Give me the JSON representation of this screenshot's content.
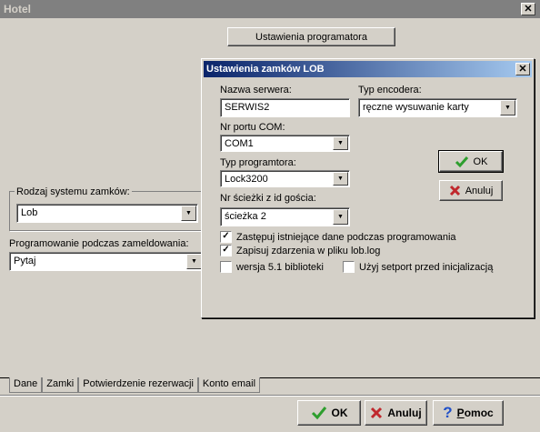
{
  "window": {
    "title": "Hotel",
    "close_glyph": "✕"
  },
  "top_button": {
    "label": "Ustawienia programatora"
  },
  "lock_system": {
    "group_label": "Rodzaj systemu zamków:",
    "value": "Lob"
  },
  "checkin_programming": {
    "label": "Programowanie podczas zameldowania:",
    "value": "Pytaj"
  },
  "tabs": [
    {
      "label": "Dane"
    },
    {
      "label": "Zamki"
    },
    {
      "label": "Potwierdzenie rezerwacji"
    },
    {
      "label": "Konto email"
    }
  ],
  "bottom_buttons": {
    "ok": {
      "label": "OK",
      "icon": "checkmark-icon"
    },
    "cancel": {
      "label": "Anuluj",
      "icon": "x-icon"
    },
    "help": {
      "label": "Pomoc",
      "icon": "question-icon"
    }
  },
  "dialog": {
    "title": "Ustawienia zamków LOB",
    "close_glyph": "✕",
    "server": {
      "label": "Nazwa serwera:",
      "value": "SERWIS2"
    },
    "encoder_type": {
      "label": "Typ encodera:",
      "value": "ręczne wysuwanie karty"
    },
    "com_port": {
      "label": "Nr portu COM:",
      "value": "COM1"
    },
    "programmer_type": {
      "label": "Typ programtora:",
      "value": "Lock3200"
    },
    "track": {
      "label": "Nr ścieżki z id gościa:",
      "value": "ścieżka 2"
    },
    "checkboxes": [
      {
        "label": "Zastępuj istniejące dane podczas programowania",
        "checked": true,
        "mark": "✓"
      },
      {
        "label": "Zapisuj zdarzenia w pliku lob.log",
        "checked": true,
        "mark": "✓"
      },
      {
        "label": "wersja 5.1 biblioteki",
        "checked": false,
        "mark": ""
      },
      {
        "label": "Użyj setport przed inicjalizacją",
        "checked": false,
        "mark": ""
      }
    ],
    "ok": {
      "label": "OK",
      "icon": "checkmark-icon"
    },
    "cancel": {
      "label": "Anuluj",
      "icon": "x-icon"
    }
  },
  "colors": {
    "check_green": "#2e9e2e",
    "cross_red": "#c0282d",
    "help_blue": "#1f4fc8",
    "title_blue": "#0a246a"
  }
}
